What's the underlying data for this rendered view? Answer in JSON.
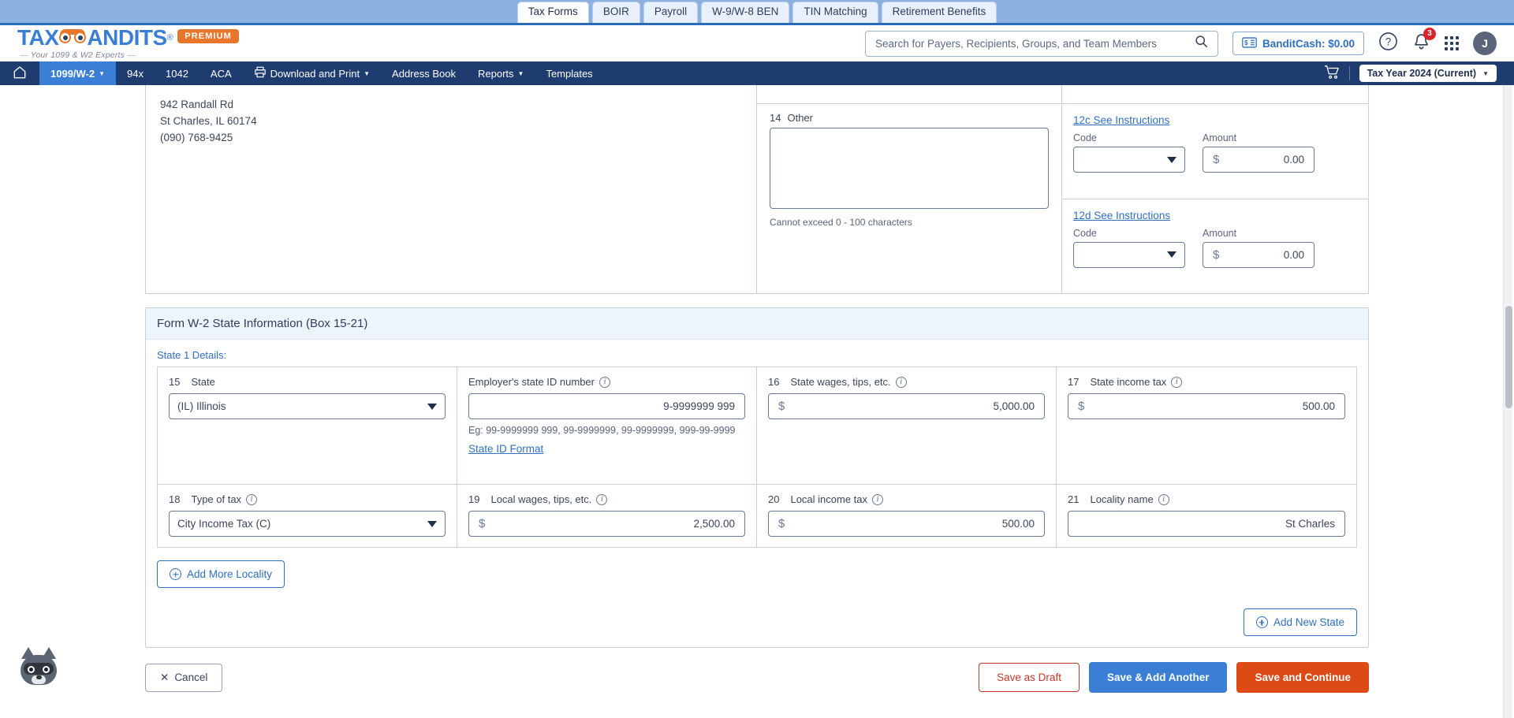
{
  "product_tabs": [
    {
      "label": "Tax Forms",
      "active": true
    },
    {
      "label": "BOIR",
      "active": false
    },
    {
      "label": "Payroll",
      "active": false
    },
    {
      "label": "W-9/W-8 BEN",
      "active": false
    },
    {
      "label": "TIN Matching",
      "active": false
    },
    {
      "label": "Retirement Benefits",
      "active": false
    }
  ],
  "brand": {
    "name_left": "TAX",
    "name_right": "ANDITS",
    "registered": "®",
    "tagline": "Your 1099 & W2 Experts",
    "plan_badge": "PREMIUM",
    "accent_blue": "#3a7fd5",
    "accent_orange": "#e8762c"
  },
  "search": {
    "placeholder": "Search for Payers, Recipients, Groups, and Team Members",
    "value": "",
    "icon": "search-icon"
  },
  "header": {
    "bandit_cash": "BanditCash: $0.00",
    "help_icon": "question-mark-circle-icon",
    "notifications_icon": "bell-icon",
    "notification_count": "3",
    "apps_icon": "grid-apps-icon",
    "avatar_initial": "J"
  },
  "nav": {
    "home_icon": "home-icon",
    "items": [
      {
        "label": "1099/W-2",
        "has_caret": true,
        "active": true
      },
      {
        "label": "94x",
        "has_caret": false,
        "active": false
      },
      {
        "label": "1042",
        "has_caret": false,
        "active": false
      },
      {
        "label": "ACA",
        "has_caret": false,
        "active": false
      },
      {
        "label": "Download and Print",
        "has_caret": true,
        "active": false,
        "icon": "printer-icon"
      },
      {
        "label": "Address Book",
        "has_caret": false,
        "active": false
      },
      {
        "label": "Reports",
        "has_caret": true,
        "active": false
      },
      {
        "label": "Templates",
        "has_caret": false,
        "active": false
      }
    ],
    "cart_icon": "shopping-cart-icon",
    "tax_year": "Tax Year 2024 (Current)"
  },
  "payer_address": {
    "line1": "942 Randall Rd",
    "line2": "St Charles, IL 60174",
    "line3": "(090) 768-9425"
  },
  "box14": {
    "num": "14",
    "label": "Other",
    "value": "",
    "helper": "Cannot exceed 0 - 100 characters"
  },
  "box12c": {
    "link": "12c See Instructions",
    "code_label": "Code",
    "code_value": "",
    "amount_label": "Amount",
    "amount_value": "0.00",
    "currency": "$"
  },
  "box12d": {
    "link": "12d See Instructions",
    "code_label": "Code",
    "code_value": "",
    "amount_label": "Amount",
    "amount_value": "0.00",
    "currency": "$"
  },
  "state_section": {
    "title": "Form W-2 State Information (Box 15-21)",
    "caption": "State 1 Details:",
    "box15": {
      "num": "15",
      "label": "State",
      "value": "(IL) Illinois"
    },
    "employer_state_id": {
      "label": "Employer's state ID number",
      "value": "9-9999999 999",
      "example": "Eg: 99-9999999 999, 99-9999999, 99-9999999, 999-99-9999",
      "format_link": "State ID Format"
    },
    "box16": {
      "num": "16",
      "label": "State wages, tips, etc.",
      "currency": "$",
      "value": "5,000.00"
    },
    "box17": {
      "num": "17",
      "label": "State income tax",
      "currency": "$",
      "value": "500.00"
    },
    "box18": {
      "num": "18",
      "label": "Type of tax",
      "value": "City Income Tax (C)"
    },
    "box19": {
      "num": "19",
      "label": "Local wages, tips, etc.",
      "currency": "$",
      "value": "2,500.00"
    },
    "box20": {
      "num": "20",
      "label": "Local income tax",
      "currency": "$",
      "value": "500.00"
    },
    "box21": {
      "num": "21",
      "label": "Locality name",
      "value": "St Charles"
    },
    "add_locality": "Add More Locality",
    "add_state": "Add New State"
  },
  "footer": {
    "cancel": "Cancel",
    "cancel_icon": "close-x-icon",
    "save_draft": "Save as Draft",
    "save_add_another": "Save & Add Another",
    "save_continue": "Save and Continue",
    "colors": {
      "draft_border": "#c0392b",
      "add_another_bg": "#3a7fd5",
      "continue_bg": "#de4a16"
    }
  },
  "mascot": {
    "name": "raccoon-mascot-icon"
  }
}
